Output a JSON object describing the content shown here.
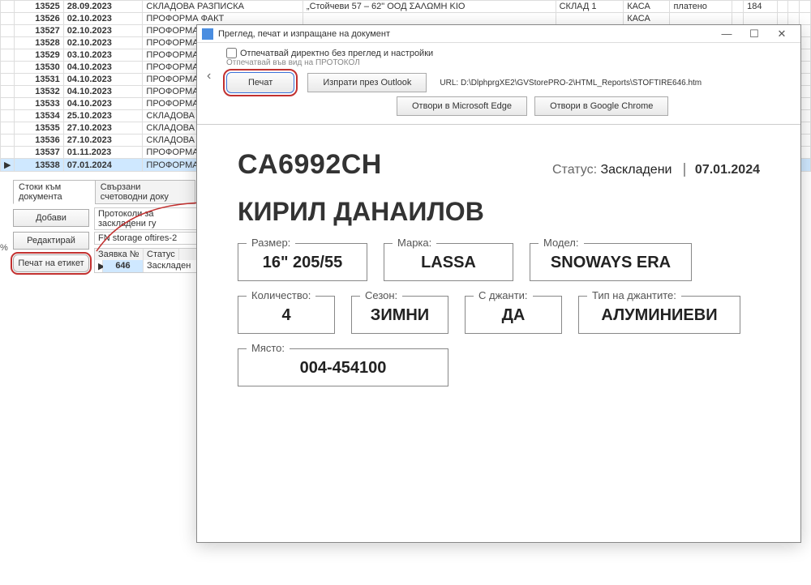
{
  "grid": {
    "rows": [
      {
        "n": "13525",
        "d": "28.09.2023",
        "t": "СКЛАДОВА РАЗПИСКА",
        "c": "„Стойчеви 57 – 62\" ООД ΣΑΛΩΜΗ ΚΙΟ",
        "w": "СКЛАД 1",
        "k": "КАСА",
        "p": "платено",
        "q": "184"
      },
      {
        "n": "13526",
        "d": "02.10.2023",
        "t": "ПРОФОРМА ФАКТ",
        "c": "",
        "w": "",
        "k": "КАСА",
        "p": "",
        "q": ""
      },
      {
        "n": "13527",
        "d": "02.10.2023",
        "t": "ПРОФОРМА ФАКТ",
        "c": "",
        "w": "",
        "k": "",
        "p": "",
        "q": ""
      },
      {
        "n": "13528",
        "d": "02.10.2023",
        "t": "ПРОФОРМА ФАКТ",
        "c": "",
        "w": "",
        "k": "",
        "p": "",
        "q": ""
      },
      {
        "n": "13529",
        "d": "03.10.2023",
        "t": "ПРОФОРМА ФАКТ",
        "c": "",
        "w": "",
        "k": "",
        "p": "",
        "q": ""
      },
      {
        "n": "13530",
        "d": "04.10.2023",
        "t": "ПРОФОРМА ФАКТ",
        "c": "",
        "w": "",
        "k": "",
        "p": "",
        "q": ""
      },
      {
        "n": "13531",
        "d": "04.10.2023",
        "t": "ПРОФОРМА ФАКТ",
        "c": "",
        "w": "",
        "k": "",
        "p": "",
        "q": ""
      },
      {
        "n": "13532",
        "d": "04.10.2023",
        "t": "ПРОФОРМА ФАКТ",
        "c": "",
        "w": "",
        "k": "",
        "p": "",
        "q": ""
      },
      {
        "n": "13533",
        "d": "04.10.2023",
        "t": "ПРОФОРМА ФАКТ",
        "c": "",
        "w": "",
        "k": "",
        "p": "",
        "q": ""
      },
      {
        "n": "13534",
        "d": "25.10.2023",
        "t": "СКЛАДОВА РАЗПИ",
        "c": "",
        "w": "",
        "k": "",
        "p": "",
        "q": ""
      },
      {
        "n": "13535",
        "d": "27.10.2023",
        "t": "СКЛАДОВА РАЗПИ",
        "c": "",
        "w": "",
        "k": "",
        "p": "",
        "q": ""
      },
      {
        "n": "13536",
        "d": "27.10.2023",
        "t": "СКЛАДОВА РАЗПИ",
        "c": "",
        "w": "",
        "k": "",
        "p": "",
        "q": ""
      },
      {
        "n": "13537",
        "d": "01.11.2023",
        "t": "ПРОФОРМА ФАКТ",
        "c": "",
        "w": "",
        "k": "",
        "p": "",
        "q": ""
      },
      {
        "n": "13538",
        "d": "07.01.2024",
        "t": "ПРОФОРМА ФАКТ",
        "c": "",
        "w": "",
        "k": "",
        "p": "",
        "q": "",
        "sel": true
      }
    ]
  },
  "left": {
    "tab1": "Стоки към документа",
    "tab2": "Свързани счетоводни доку",
    "proto": "Протоколи за заскладени гу",
    "storage": "FN storage oftires-2",
    "add": "Добави",
    "edit": "Редактирай",
    "print": "Печат на етикет",
    "req_lbl": "Заявка №",
    "stat_lbl": "Статус",
    "req_val": "646",
    "stat_val": "Заскладен"
  },
  "dialog": {
    "title": "Преглед, печат и изпращане на документ",
    "chk": "Отпечатвай директно без преглед и настройки",
    "sub": "Отпечатвай във вид на ПРОТОКОЛ",
    "print": "Печат",
    "outlook": "Изпрати през Outlook",
    "url_lbl": "URL:",
    "url": "D:\\DlphprgXE2\\GVStorePRO-2\\HTML_Reports\\STOFTIRE646.htm",
    "edge": "Отвори в Microsoft Edge",
    "chrome": "Отвори в Google Chrome"
  },
  "doc": {
    "plate": "CA6992CH",
    "status_lbl": "Статус:",
    "status_val": "Заскладени",
    "date": "07.01.2024",
    "owner": "КИРИЛ ДАНАИЛОВ",
    "f": {
      "size_l": "Размер:",
      "size_v": "16\" 205/55",
      "brand_l": "Марка:",
      "brand_v": "LASSA",
      "model_l": "Модел:",
      "model_v": "SNOWAYS ERA",
      "qty_l": "Количество:",
      "qty_v": "4",
      "season_l": "Сезон:",
      "season_v": "ЗИМНИ",
      "rims_l": "С джанти:",
      "rims_v": "ДА",
      "rimtype_l": "Тип на джантите:",
      "rimtype_v": "АЛУМИНИЕВИ",
      "place_l": "Място:",
      "place_v": "004-454100"
    }
  },
  "pct": "%"
}
